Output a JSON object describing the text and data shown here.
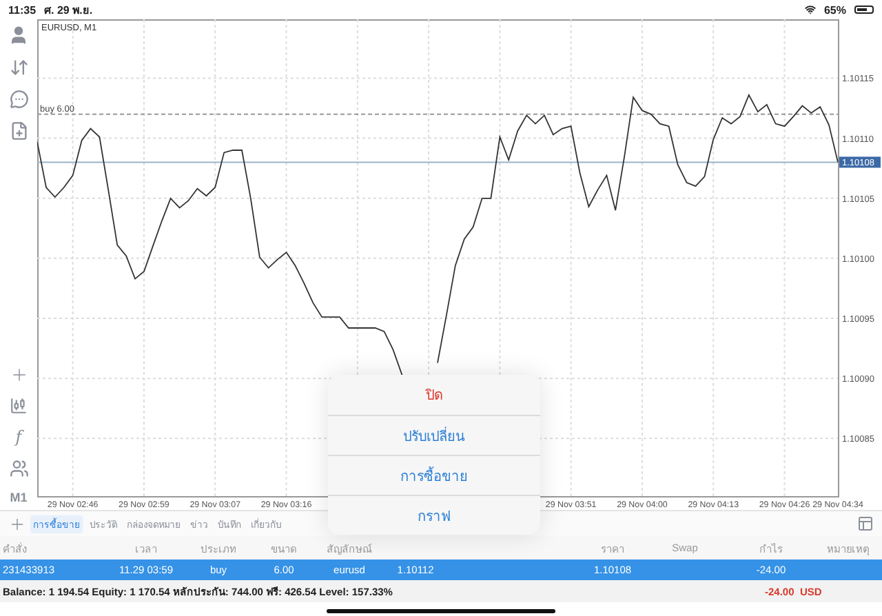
{
  "status_bar": {
    "time": "11:35",
    "date": "ศ. 29 พ.ย.",
    "battery": "65%"
  },
  "toolbar": {
    "indicators_glyph": "f",
    "timeframe": "M1"
  },
  "chart": {
    "chart_data": {
      "type": "line",
      "title": "EURUSD, M1",
      "grid": true,
      "ylim": [
        1.100802,
        1.101199
      ],
      "categories": [
        null,
        null,
        null,
        null,
        "29 Nov 02:46",
        null,
        null,
        null,
        null,
        null,
        null,
        null,
        "29 Nov 02:59",
        null,
        null,
        null,
        null,
        null,
        null,
        null,
        "29 Nov 03:07",
        null,
        null,
        null,
        null,
        null,
        null,
        null,
        "29 Nov 03:16",
        null,
        null,
        null,
        null,
        null,
        null,
        null,
        null,
        null,
        null,
        null,
        null,
        null,
        null,
        null,
        null,
        null,
        null,
        null,
        null,
        null,
        null,
        null,
        null,
        null,
        null,
        null,
        null,
        null,
        null,
        null,
        "29 Nov 03:51",
        null,
        null,
        null,
        null,
        null,
        null,
        null,
        "29 Nov 04:00",
        null,
        null,
        null,
        null,
        null,
        null,
        null,
        "29 Nov 04:13",
        null,
        null,
        null,
        null,
        null,
        null,
        null,
        "29 Nov 04:26",
        null,
        null,
        null,
        null,
        null,
        "29 Nov 04:34"
      ],
      "yticks": [
        {
          "value": 1.10115,
          "label": "1.10115"
        },
        {
          "value": 1.1011,
          "label": "1.10110"
        },
        {
          "value": 1.10105,
          "label": "1.10105"
        },
        {
          "value": 1.101,
          "label": "1.10100"
        },
        {
          "value": 1.10095,
          "label": "1.10095"
        },
        {
          "value": 1.1009,
          "label": "1.10090"
        },
        {
          "value": 1.10085,
          "label": "1.10085"
        }
      ],
      "series": [
        {
          "color": "#333333",
          "values": [
            1.101097,
            1.101059,
            1.101051,
            1.101059,
            1.101069,
            1.101098,
            1.101108,
            1.101101,
            1.101057,
            1.101011,
            1.101002,
            1.100983,
            1.100989,
            1.10101,
            1.101031,
            1.10105,
            1.101042,
            1.101048,
            1.101058,
            1.101052,
            1.101059,
            1.101088,
            1.10109,
            1.10109,
            1.10105,
            1.101001,
            1.100992,
            1.100999,
            1.101005,
            1.100994,
            1.100979,
            1.100963,
            1.100951,
            1.100951,
            1.100951,
            1.100942,
            1.100942,
            1.100942,
            1.100942,
            1.100939,
            1.100924,
            1.100903,
            null,
            null,
            null,
            1.100913,
            1.100953,
            1.100994,
            1.101016,
            1.101026,
            1.10105,
            1.10105,
            1.101101,
            1.101082,
            1.101106,
            1.101119,
            1.101112,
            1.101119,
            1.101103,
            1.101108,
            1.10111,
            1.101071,
            1.101043,
            1.101057,
            1.101069,
            1.10104,
            1.101085,
            1.101134,
            1.101123,
            1.10112,
            1.101112,
            1.10111,
            1.101078,
            1.101063,
            1.10106,
            1.101068,
            1.101099,
            1.101117,
            1.101112,
            1.101118,
            1.101136,
            1.101122,
            1.101128,
            1.101112,
            1.10111,
            1.101118,
            1.101127,
            1.101121,
            1.101126,
            1.101111,
            1.10108
          ]
        }
      ],
      "ref_lines": [
        {
          "axis": "y",
          "value": 1.10112,
          "label": "buy 6.00",
          "color": "#999999"
        },
        {
          "axis": "y",
          "value": 1.10108,
          "label": "1.10108",
          "color": "#9bb2cc"
        }
      ]
    }
  },
  "tabs": [
    {
      "label": "การซื้อขาย",
      "selected": true
    },
    {
      "label": "ประวัติ",
      "selected": false
    },
    {
      "label": "กล่องจดหมาย",
      "selected": false
    },
    {
      "label": "ข่าว",
      "selected": false
    },
    {
      "label": "บันทึก",
      "selected": false
    },
    {
      "label": "เกี่ยวกับ",
      "selected": false
    }
  ],
  "table": {
    "columns": [
      {
        "label": "คำสั่ง"
      },
      {
        "label": "เวลา"
      },
      {
        "label": "ประเภท"
      },
      {
        "label": "ขนาด"
      },
      {
        "label": "สัญลักษณ์"
      },
      {},
      {},
      {},
      {
        "label": "ราคา"
      },
      {
        "label": "Swap"
      },
      {
        "label": "กำไร"
      },
      {
        "label": "หมายเหตุ"
      }
    ],
    "rows": [
      {
        "selected": true,
        "cells": [
          "231433913",
          "11.29 03:59",
          "buy",
          "6.00",
          "eurusd",
          "1.10112",
          "",
          "",
          "1.10108",
          "",
          "-24.00",
          ""
        ]
      }
    ]
  },
  "summary": {
    "text": "Balance: 1 194.54 Equity: 1 170.54 หลักประกัน: 744.00 ฟรี: 426.54 Level: 157.33%",
    "profit": "-24.00",
    "currency": "USD"
  },
  "popup_menu": [
    {
      "label": "ปิด",
      "kind": "destructive"
    },
    {
      "label": "ปรับเปลี่ยน",
      "kind": "default"
    },
    {
      "label": "การซื้อขาย",
      "kind": "default"
    },
    {
      "label": "กราฟ",
      "kind": "default"
    }
  ]
}
